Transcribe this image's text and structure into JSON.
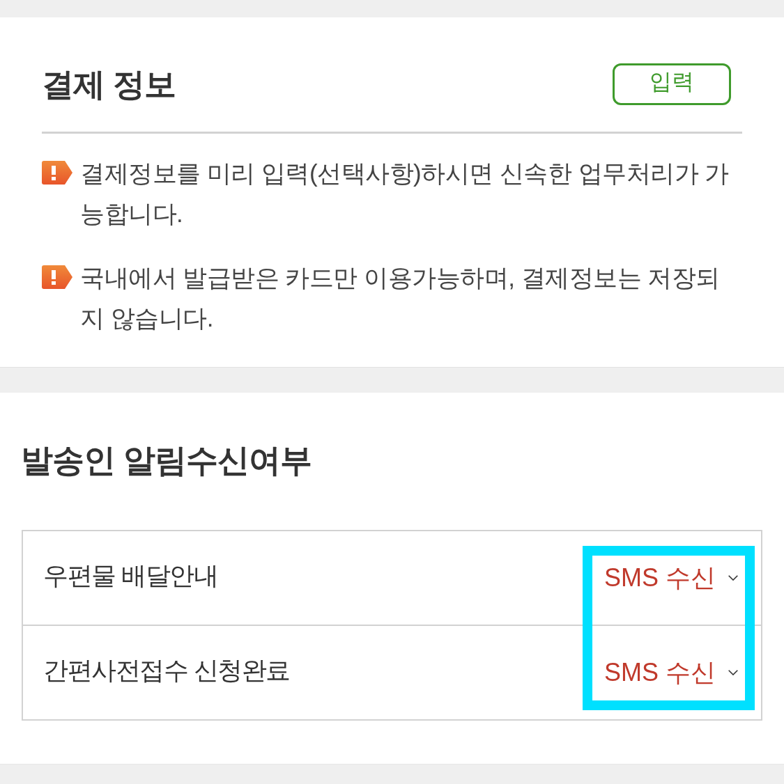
{
  "payment_info": {
    "title": "결제 정보",
    "input_button": "입력",
    "notices": [
      "결제정보를 미리 입력(선택사항)하시면 신속한 업무처리가 가능합니다.",
      "국내에서 발급받은 카드만 이용가능하며, 결제정보는 저장되지 않습니다."
    ]
  },
  "sender_notifications": {
    "title": "발송인 알림수신여부",
    "highlighted": true,
    "rows": [
      {
        "label": "우편물 배달안내",
        "option": "SMS 수신"
      },
      {
        "label": "간편사전접수 신청완료",
        "option": "SMS 수신"
      }
    ]
  }
}
